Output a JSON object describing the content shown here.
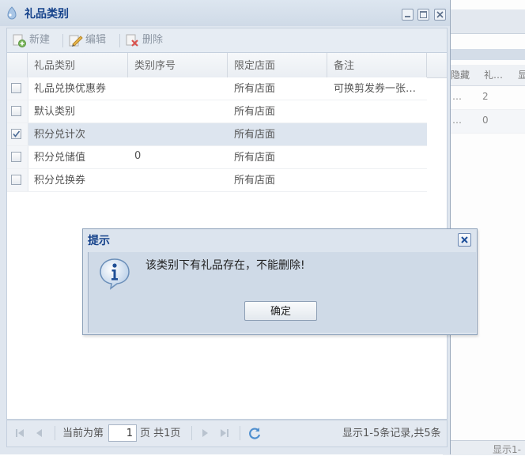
{
  "window": {
    "title": "礼品类别"
  },
  "toolbar": {
    "new_label": "新建",
    "edit_label": "编辑",
    "delete_label": "删除"
  },
  "grid": {
    "columns": [
      "礼品类别",
      "类别序号",
      "限定店面",
      "备注"
    ],
    "rows": [
      {
        "category": "礼品兑换优惠券",
        "seq": "",
        "store": "所有店面",
        "note": "可换剪发券一张…",
        "checked": false,
        "selected": false
      },
      {
        "category": "默认类别",
        "seq": "",
        "store": "所有店面",
        "note": "",
        "checked": false,
        "selected": false
      },
      {
        "category": "积分兑计次",
        "seq": "",
        "store": "所有店面",
        "note": "",
        "checked": true,
        "selected": true
      },
      {
        "category": "积分兑储值",
        "seq": "0",
        "store": "所有店面",
        "note": "",
        "checked": false,
        "selected": false
      },
      {
        "category": "积分兑换券",
        "seq": "",
        "store": "所有店面",
        "note": "",
        "checked": false,
        "selected": false
      }
    ]
  },
  "pager": {
    "prefix": "当前为第",
    "page": "1",
    "suffix": "页 共1页",
    "summary": "显示1-5条记录,共5条"
  },
  "dialog": {
    "title": "提示",
    "message": "该类别下有礼品存在，不能删除!",
    "ok_label": "确定"
  },
  "background": {
    "columns": [
      "隐藏",
      "礼…",
      "显"
    ],
    "row1": {
      "c1": "…",
      "c2": "2"
    },
    "row2": {
      "c1": "…",
      "c2": "0"
    },
    "bottom_text": "显示1-"
  },
  "colors": {
    "title_text": "#15428b",
    "selected_row": "#dde5ef",
    "panel_bg": "#dfe6ef"
  }
}
